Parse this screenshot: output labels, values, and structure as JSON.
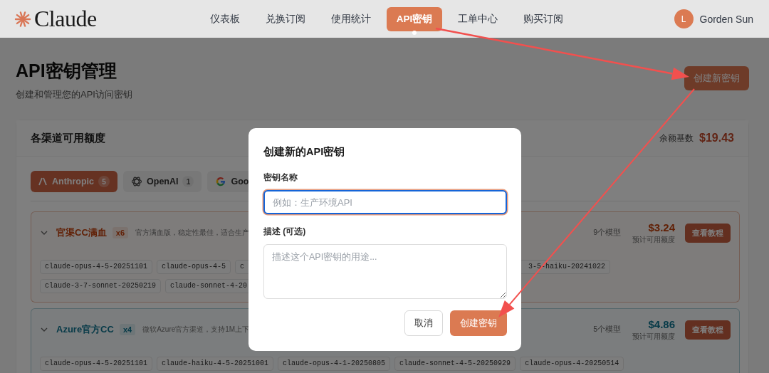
{
  "nav": {
    "logo": "Claude",
    "items": [
      {
        "label": "仪表板",
        "selected": false
      },
      {
        "label": "兑换订阅",
        "selected": false
      },
      {
        "label": "使用统计",
        "selected": false
      },
      {
        "label": "API密钥",
        "selected": true
      },
      {
        "label": "工单中心",
        "selected": false
      },
      {
        "label": "购买订阅",
        "selected": false
      }
    ],
    "user": {
      "initial": "L",
      "name": "Gorden Sun"
    }
  },
  "header": {
    "title": "API密钥管理",
    "subtitle": "创建和管理您的API访问密钥",
    "create_button": "创建新密钥"
  },
  "quota_panel": {
    "title": "各渠道可用额度",
    "balance_label": "余额基数",
    "balance": "$19.43",
    "tabs": [
      {
        "label": "Anthropic",
        "count": "5",
        "selected": true
      },
      {
        "label": "OpenAI",
        "count": "1",
        "selected": false
      },
      {
        "label": "Goo",
        "selected": false
      }
    ],
    "channels": [
      {
        "kind": "warm",
        "name": "官渠CC满血",
        "multiplier": "x6",
        "description": "官方满血版，稳定性最佳，适合生产",
        "expanded": true,
        "model_count": "9个模型",
        "amount": "$3.24",
        "amount_label": "预计可用额度",
        "tutorial_button": "查看教程",
        "models": [
          [
            {
              "kind": "full",
              "text": "claude-opus-4-5-20251101"
            },
            {
              "kind": "full",
              "text": "claude-opus-4-5"
            },
            {
              "kind": "clipped_end",
              "text": "c"
            },
            {
              "kind": "clipped_start",
              "text": "3-5-haiku-20241022"
            }
          ],
          [
            {
              "kind": "full",
              "text": "claude-3-7-sonnet-20250219"
            },
            {
              "kind": "clipped_end",
              "text": "claude-sonnet-4-20"
            }
          ]
        ]
      },
      {
        "kind": "cool",
        "name": "Azure官方CC",
        "multiplier": "x4",
        "description": "微软Azure官方渠道，支持1M上下",
        "expanded": true,
        "model_count": "5个模型",
        "amount": "$4.86",
        "amount_label": "预计可用额度",
        "tutorial_button": "查看教程",
        "models": [
          [
            {
              "kind": "full",
              "text": "claude-opus-4-5-20251101"
            },
            {
              "kind": "full",
              "text": "claude-haiku-4-5-20251001"
            },
            {
              "kind": "full",
              "text": "claude-opus-4-1-20250805"
            },
            {
              "kind": "full",
              "text": "claude-sonnet-4-5-20250929"
            },
            {
              "kind": "full",
              "text": "claude-opus-4-20250514"
            }
          ]
        ]
      }
    ]
  },
  "modal": {
    "title": "创建新的API密钥",
    "fields": [
      {
        "kind": "input",
        "label": "密钥名称",
        "placeholder": "例如：生产环境API",
        "focused": true
      },
      {
        "kind": "textarea",
        "label": "描述 (可选)",
        "placeholder": "描述这个API密钥的用途...",
        "focused": false
      }
    ],
    "buttons": [
      {
        "kind": "secondary",
        "label": "取消"
      },
      {
        "kind": "primary",
        "label": "创建密钥"
      }
    ]
  },
  "annotations": [
    {
      "kind": "arrow"
    },
    {
      "kind": "arrow"
    }
  ]
}
